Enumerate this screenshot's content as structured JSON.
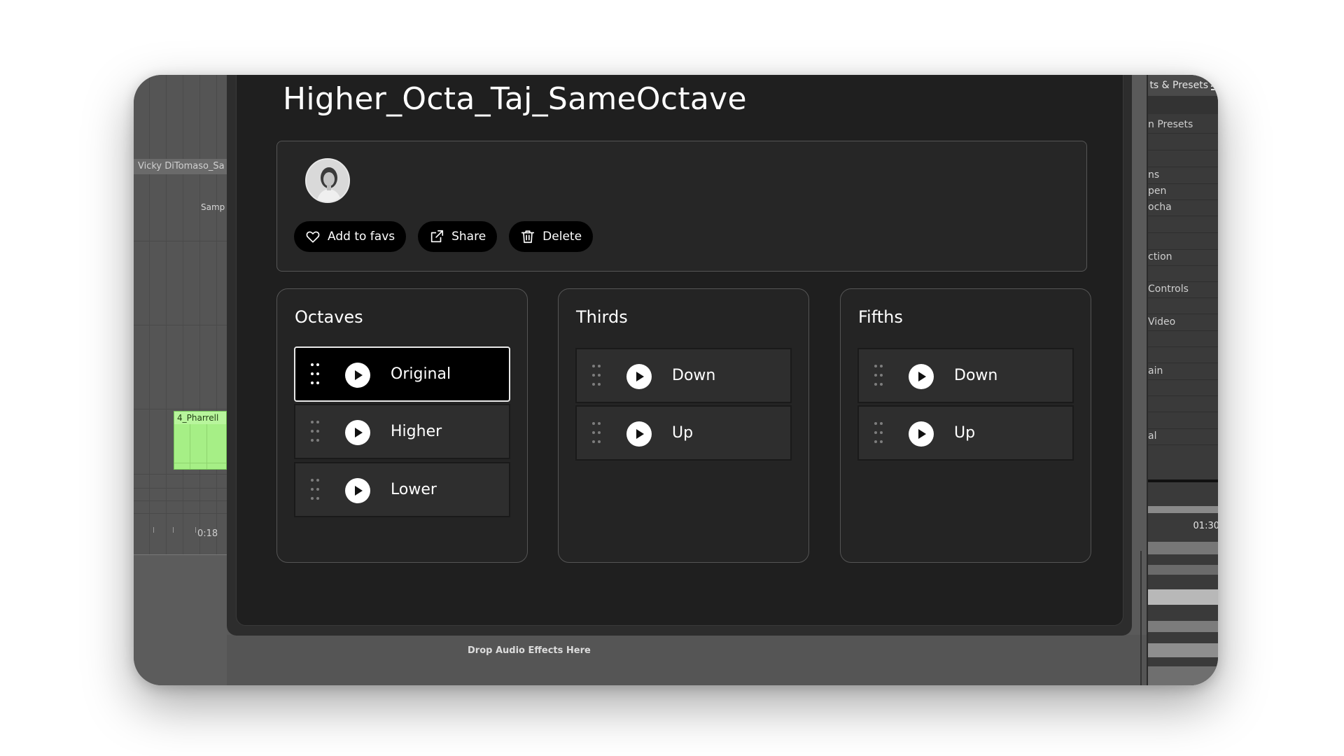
{
  "background_daw": {
    "track_name": "Vicky DiTomaso_Sa",
    "samp_label": "Samp",
    "clip_label": "4_Pharrell",
    "time_left": "0:18",
    "time_right": "01:30",
    "drop_text": "Drop Audio Effects Here",
    "clip_color": "#a6ef86"
  },
  "right_panel": {
    "header": "ts & Presets",
    "items": [
      "n Presets",
      "ns",
      "pen",
      "ocha",
      "ction",
      "Controls",
      "Video",
      "ain",
      "al"
    ]
  },
  "sample": {
    "title": "Higher_Octa_Taj_SameOctave"
  },
  "actions": {
    "fav_label": "Add to favs",
    "share_label": "Share",
    "delete_label": "Delete"
  },
  "groups": {
    "octaves": {
      "title": "Octaves",
      "items": [
        "Original",
        "Higher",
        "Lower"
      ],
      "selected": "Original"
    },
    "thirds": {
      "title": "Thirds",
      "items": [
        "Down",
        "Up"
      ]
    },
    "fifths": {
      "title": "Fifths",
      "items": [
        "Down",
        "Up"
      ]
    }
  },
  "icons": {
    "fav": "heart-icon",
    "share": "share-icon",
    "delete": "trash-icon",
    "play": "play-icon",
    "drag": "drag-handle-icon"
  }
}
